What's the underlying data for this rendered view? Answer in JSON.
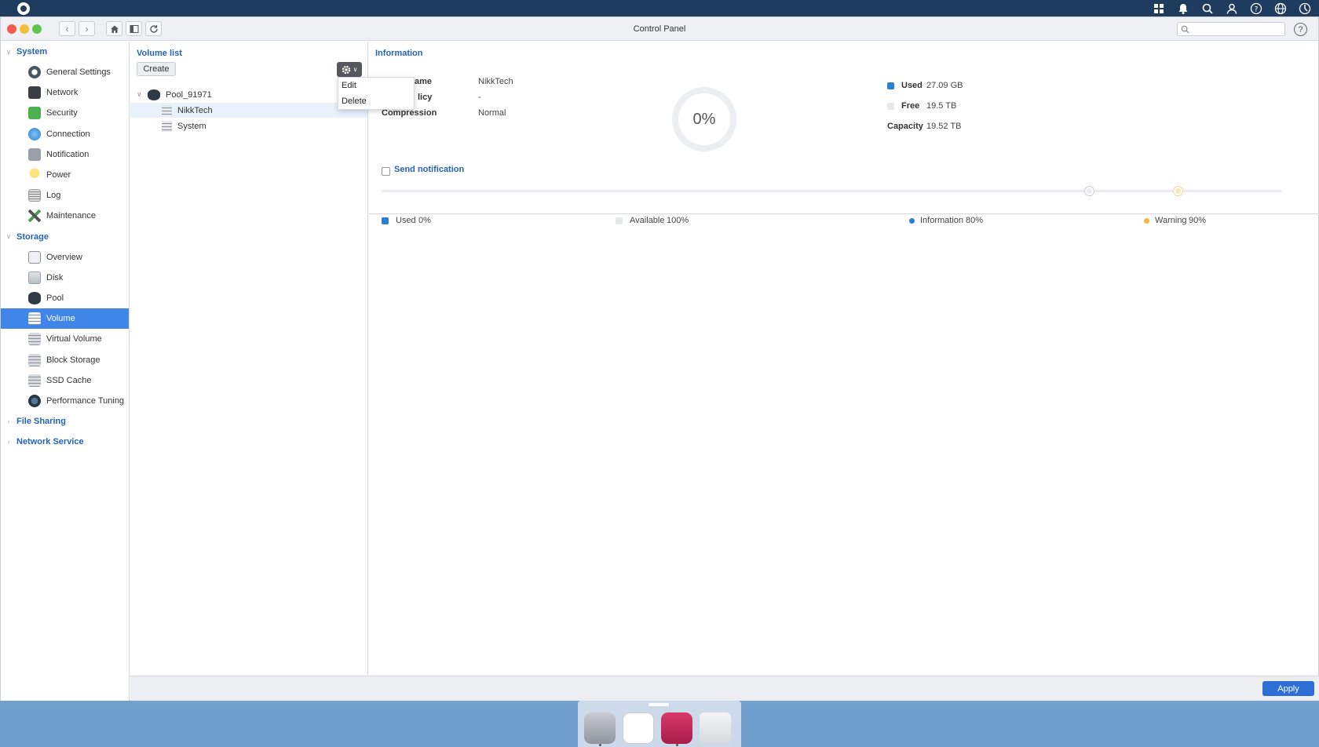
{
  "window": {
    "title": "Control Panel",
    "search_placeholder": ""
  },
  "sidebar": {
    "groups": [
      {
        "label": "System",
        "expanded": true,
        "items": [
          {
            "label": "General Settings",
            "icon": "gear-icon"
          },
          {
            "label": "Network",
            "icon": "network-icon"
          },
          {
            "label": "Security",
            "icon": "lock-icon"
          },
          {
            "label": "Connection",
            "icon": "globe-icon"
          },
          {
            "label": "Notification",
            "icon": "bell-icon"
          },
          {
            "label": "Power",
            "icon": "bulb-icon"
          },
          {
            "label": "Log",
            "icon": "log-icon"
          },
          {
            "label": "Maintenance",
            "icon": "tools-icon"
          }
        ]
      },
      {
        "label": "Storage",
        "expanded": true,
        "items": [
          {
            "label": "Overview",
            "icon": "overview-icon"
          },
          {
            "label": "Disk",
            "icon": "disk-icon"
          },
          {
            "label": "Pool",
            "icon": "pool-icon"
          },
          {
            "label": "Volume",
            "icon": "volume-icon",
            "active": true
          },
          {
            "label": "Virtual Volume",
            "icon": "virtual-volume-icon"
          },
          {
            "label": "Block Storage",
            "icon": "block-storage-icon"
          },
          {
            "label": "SSD Cache",
            "icon": "ssd-cache-icon"
          },
          {
            "label": "Performance Tuning",
            "icon": "performance-icon"
          }
        ]
      },
      {
        "label": "File Sharing",
        "expanded": false,
        "items": []
      },
      {
        "label": "Network Service",
        "expanded": false,
        "items": []
      }
    ]
  },
  "volume_list": {
    "title": "Volume list",
    "create_label": "Create",
    "pool": "Pool_91971",
    "volumes": [
      "NikkTech",
      "System"
    ],
    "selected": "NikkTech",
    "menu": [
      "Edit",
      "Delete"
    ]
  },
  "info": {
    "title": "Information",
    "rows": [
      {
        "label": "ame",
        "value": "NikkTech"
      },
      {
        "label": "licy",
        "value": "-"
      },
      {
        "label": "Compression",
        "value": "Normal"
      }
    ],
    "donut_percent": "0%",
    "usage_fraction": 0,
    "stats": [
      {
        "label": "Used",
        "value": "27.09 GB",
        "color": "#2a7fd4"
      },
      {
        "label": "Free",
        "value": "19.5 TB",
        "color": "#e6e8eb"
      },
      {
        "label": "Capacity",
        "value": "19.52 TB"
      }
    ],
    "send_notification": "Send notification",
    "thresholds": [
      {
        "label": "Used",
        "value": "0%",
        "color": "#2a7fd4"
      },
      {
        "label": "Available",
        "value": "100%",
        "color": "#e6e8eb"
      },
      {
        "label": "Information",
        "value": "80%",
        "color": "#2a7fd4"
      },
      {
        "label": "Warning",
        "value": "90%",
        "color": "#f4b73a"
      }
    ]
  },
  "footer": {
    "apply_label": "Apply"
  },
  "colors": {
    "accent": "#3f86e8",
    "title_blue": "#2463b5",
    "topbar": "#1e3c5e"
  }
}
